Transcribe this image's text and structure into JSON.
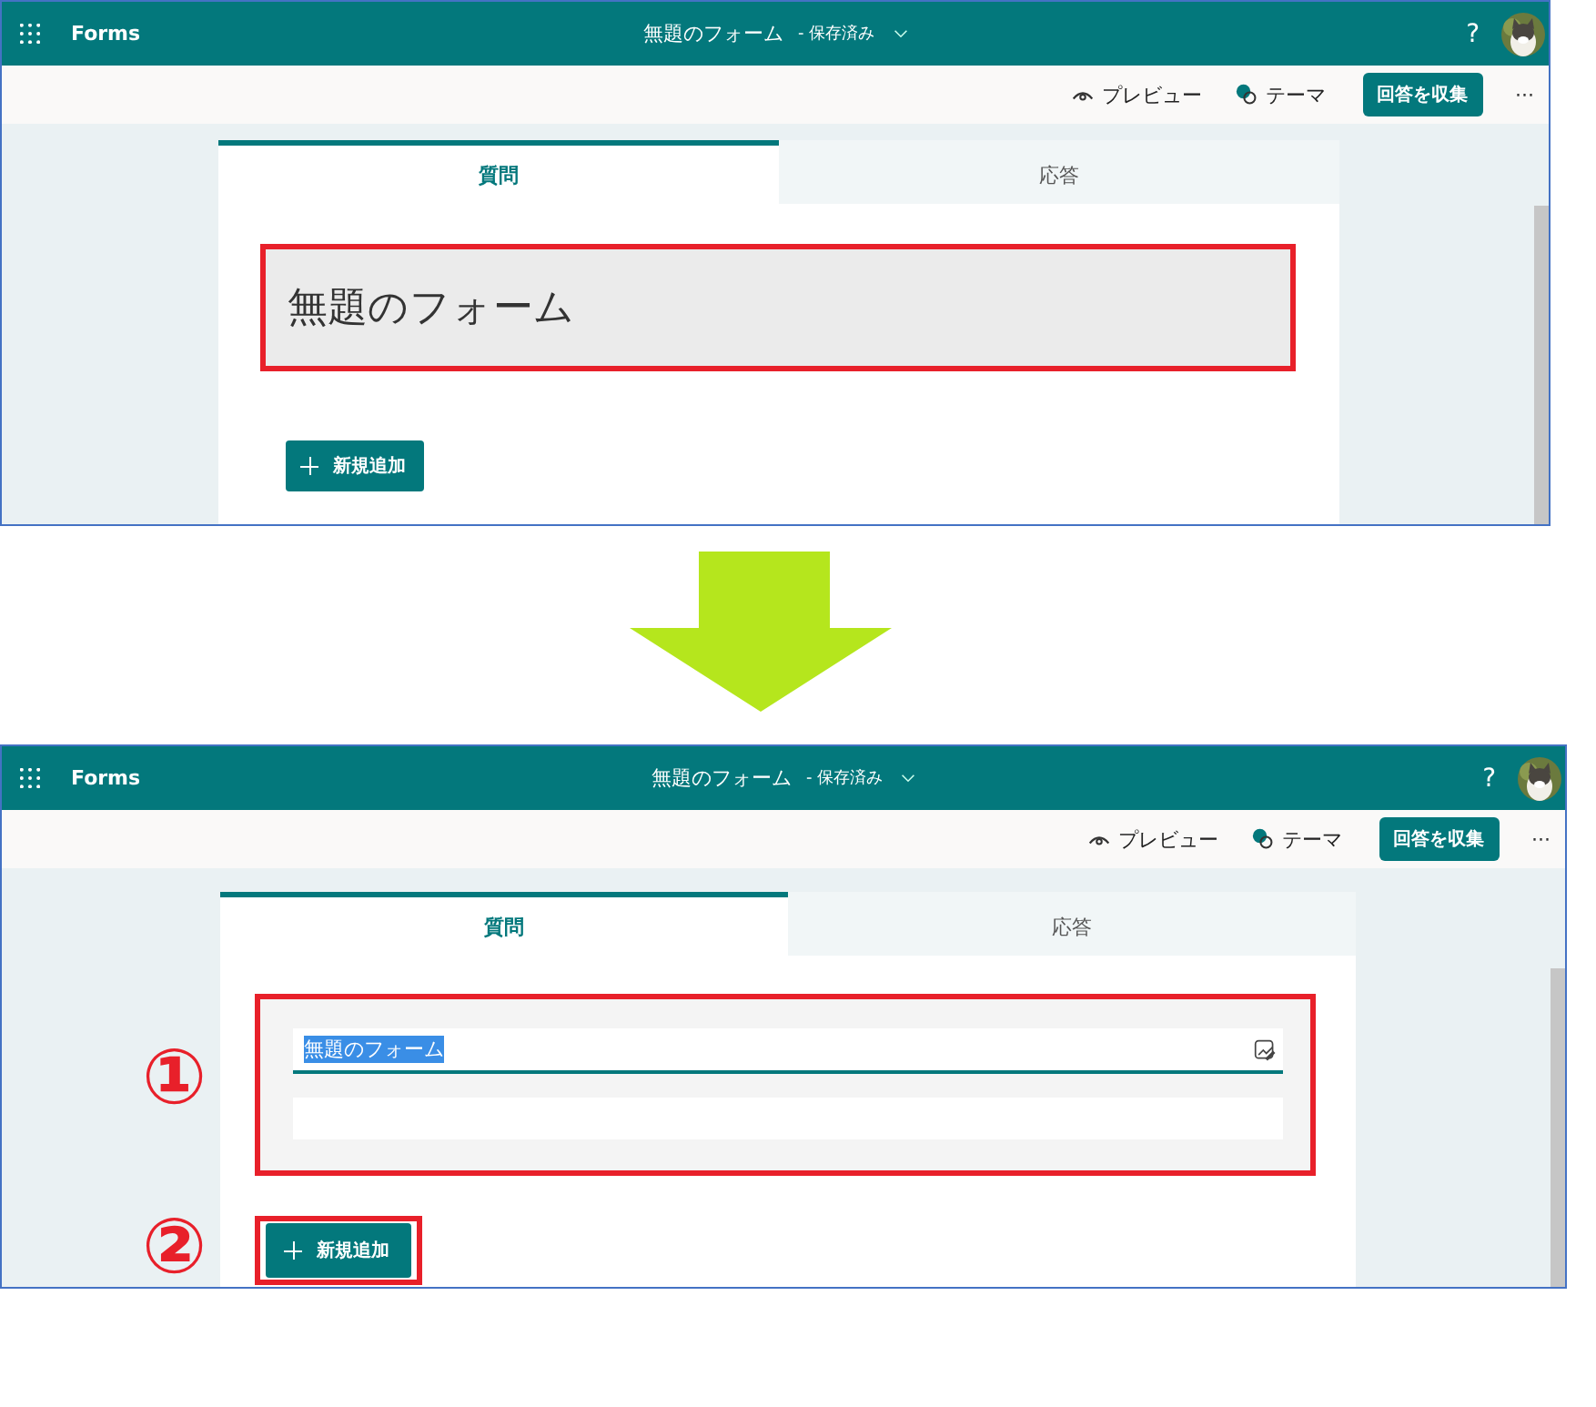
{
  "screens": [
    {
      "app_name": "Forms",
      "form_title": "無題のフォーム",
      "save_status": "- 保存済み",
      "help": "?",
      "toolbar": {
        "preview": "プレビュー",
        "theme": "テーマ",
        "collect": "回答を収集",
        "more": "···"
      },
      "tabs": [
        {
          "label": "質問",
          "selected": true
        },
        {
          "label": "応答",
          "selected": false
        }
      ],
      "title_block": {
        "kind": "heading",
        "text": "無題のフォーム",
        "highlighted": true
      },
      "add_button": {
        "label": "新規追加",
        "highlighted": false
      }
    },
    {
      "app_name": "Forms",
      "form_title": "無題のフォーム",
      "save_status": "- 保存済み",
      "help": "?",
      "toolbar": {
        "preview": "プレビュー",
        "theme": "テーマ",
        "collect": "回答を収集",
        "more": "···"
      },
      "tabs": [
        {
          "label": "質問",
          "selected": true
        },
        {
          "label": "応答",
          "selected": false
        }
      ],
      "title_block": {
        "kind": "editing",
        "text": "無題のフォーム",
        "text_selected": true,
        "highlighted": true,
        "step_number": "①"
      },
      "add_button": {
        "label": "新規追加",
        "highlighted": true,
        "step_number": "②"
      }
    }
  ]
}
